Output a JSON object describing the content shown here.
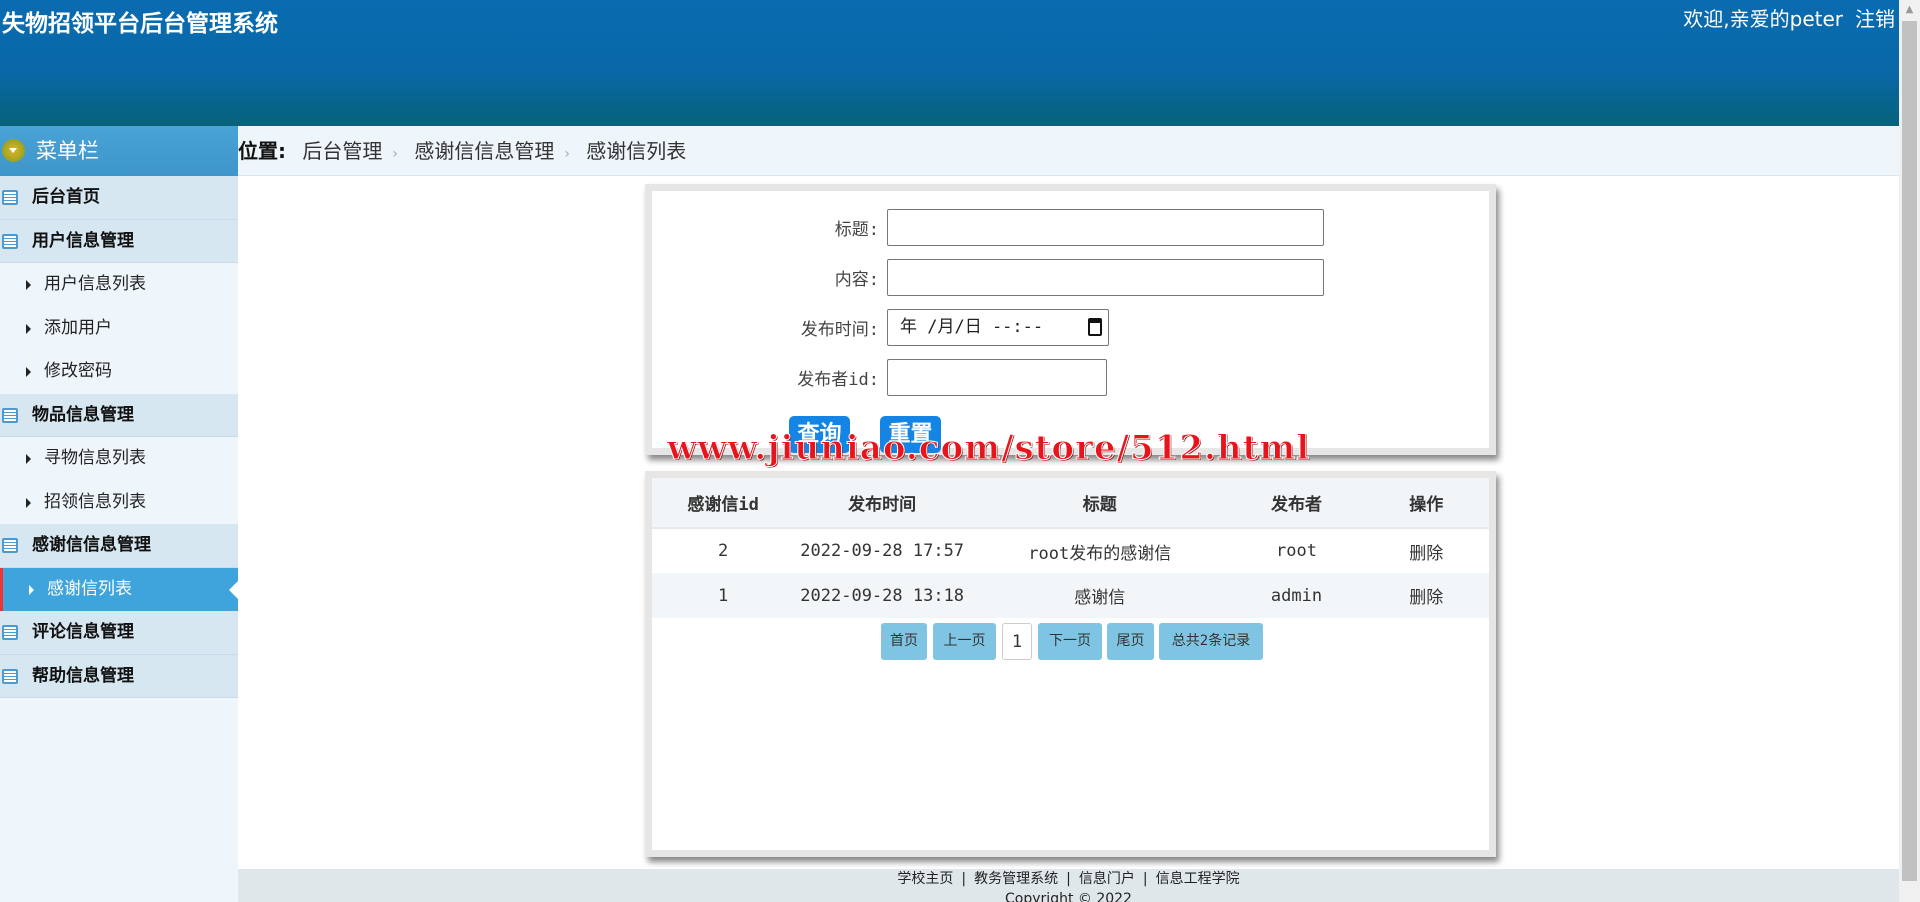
{
  "header": {
    "title": "失物招领平台后台管理系统",
    "welcome": "欢迎,亲爱的peter",
    "logout": "注销"
  },
  "sidebar": {
    "menu_title": "菜单栏",
    "items": [
      {
        "type": "group",
        "label": "后台首页"
      },
      {
        "type": "group",
        "label": "用户信息管理"
      },
      {
        "type": "sub",
        "label": "用户信息列表"
      },
      {
        "type": "sub",
        "label": "添加用户"
      },
      {
        "type": "sub",
        "label": "修改密码"
      },
      {
        "type": "group",
        "label": "物品信息管理"
      },
      {
        "type": "sub",
        "label": "寻物信息列表"
      },
      {
        "type": "sub",
        "label": "招领信息列表"
      },
      {
        "type": "group",
        "label": "感谢信信息管理"
      },
      {
        "type": "sub",
        "label": "感谢信列表",
        "active": true
      },
      {
        "type": "group",
        "label": "评论信息管理"
      },
      {
        "type": "group",
        "label": "帮助信息管理"
      }
    ]
  },
  "breadcrumb": {
    "label": "位置:",
    "items": [
      "后台管理",
      "感谢信信息管理",
      "感谢信列表"
    ]
  },
  "form": {
    "title_label": "标题:",
    "content_label": "内容:",
    "time_label": "发布时间:",
    "time_placeholder": "年 /月/日 --:--",
    "publisher_label": "发布者id:",
    "search_button": "查询",
    "reset_button": "重置"
  },
  "watermark": "www.jiuniao.com/store/512.html",
  "table": {
    "columns": [
      "感谢信id",
      "发布时间",
      "标题",
      "发布者",
      "操作"
    ],
    "rows": [
      [
        "2",
        "2022-09-28 17:57",
        "root发布的感谢信",
        "root",
        "删除"
      ],
      [
        "1",
        "2022-09-28 13:18",
        "感谢信",
        "admin",
        "删除"
      ]
    ]
  },
  "pagination": {
    "first": "首页",
    "prev": "上一页",
    "current": "1",
    "next": "下一页",
    "last": "尾页",
    "total": "总共2条记录"
  },
  "footer": {
    "links": [
      "学校主页",
      "教务管理系统",
      "信息门户",
      "信息工程学院"
    ],
    "copyright": "Copyright © 2022"
  }
}
